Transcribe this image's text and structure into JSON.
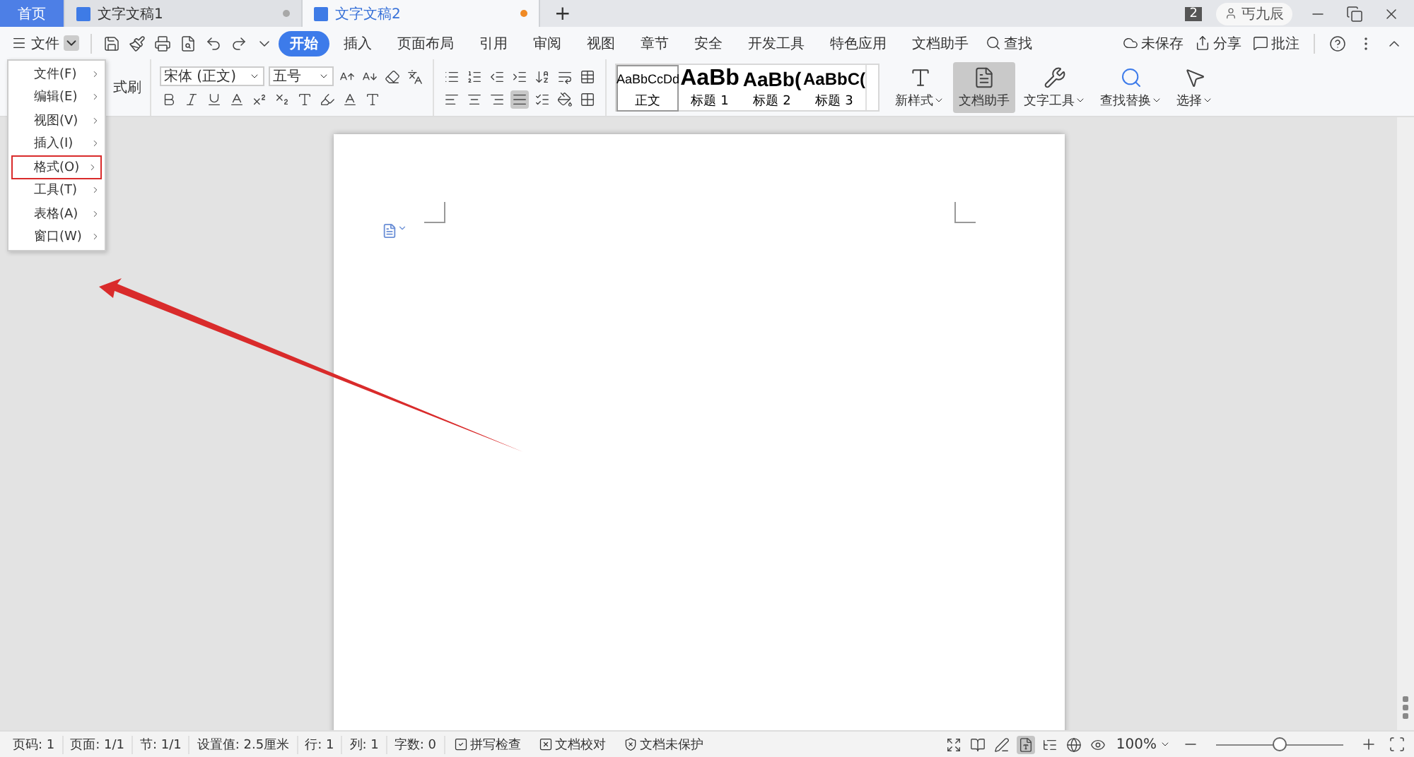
{
  "tabs": [
    {
      "label": "首页",
      "kind": "home"
    },
    {
      "label": "文字文稿1",
      "kind": "doc",
      "selected": false,
      "modified": false
    },
    {
      "label": "文字文稿2",
      "kind": "doc",
      "selected": true,
      "modified": true
    }
  ],
  "new_tab": "+",
  "window_count": "2",
  "user": "丐九辰",
  "file_menu": "文件",
  "ribbon_tabs": [
    {
      "label": "开始",
      "selected": true
    },
    {
      "label": "插入",
      "selected": false
    },
    {
      "label": "页面布局",
      "selected": false
    },
    {
      "label": "引用",
      "selected": false
    },
    {
      "label": "审阅",
      "selected": false
    },
    {
      "label": "视图",
      "selected": false
    },
    {
      "label": "章节",
      "selected": false
    },
    {
      "label": "安全",
      "selected": false
    },
    {
      "label": "开发工具",
      "selected": false
    },
    {
      "label": "特色应用",
      "selected": false
    },
    {
      "label": "文档助手",
      "selected": false
    }
  ],
  "search_tab": "查找",
  "right_actions": [
    {
      "kind": "cloud",
      "label": "未保存"
    },
    {
      "kind": "share",
      "label": "分享"
    },
    {
      "kind": "comment",
      "label": "批注"
    }
  ],
  "ribbon": {
    "format_painter": "式刷",
    "font": "宋体 (正文)",
    "size": "五号",
    "alignments": [
      {
        "kind": "left",
        "selected": false
      },
      {
        "kind": "center",
        "selected": false
      },
      {
        "kind": "right",
        "selected": false
      },
      {
        "kind": "justify",
        "selected": true
      }
    ],
    "styles": [
      {
        "preview": "AaBbCcDd",
        "label": "正文",
        "kind": "body",
        "selected": true
      },
      {
        "preview": "AaBb",
        "label": "标题 1",
        "kind": "h1",
        "selected": false
      },
      {
        "preview": "AaBb(",
        "label": "标题 2",
        "kind": "h2",
        "selected": false
      },
      {
        "preview": "AaBbC(",
        "label": "标题 3",
        "kind": "h3",
        "selected": false
      }
    ],
    "tools": [
      {
        "kind": "new_style",
        "label": "新样式",
        "selected": false,
        "dropdown": true
      },
      {
        "kind": "assistant",
        "label": "文档助手",
        "selected": true,
        "dropdown": false
      },
      {
        "kind": "text_tools",
        "label": "文字工具",
        "selected": false,
        "dropdown": true
      },
      {
        "kind": "find_replace",
        "label": "查找替换",
        "selected": false,
        "dropdown": true
      },
      {
        "kind": "select",
        "label": "选择",
        "selected": false,
        "dropdown": true
      }
    ]
  },
  "dropdown": [
    {
      "label": "文件(F)",
      "highlighted": false
    },
    {
      "label": "编辑(E)",
      "highlighted": false
    },
    {
      "label": "视图(V)",
      "highlighted": false
    },
    {
      "label": "插入(I)",
      "highlighted": false
    },
    {
      "label": "格式(O)",
      "highlighted": true
    },
    {
      "label": "工具(T)",
      "highlighted": false
    },
    {
      "label": "表格(A)",
      "highlighted": false
    },
    {
      "label": "窗口(W)",
      "highlighted": false
    }
  ],
  "status": {
    "items": [
      "页码: 1",
      "页面: 1/1",
      "节: 1/1",
      "设置值: 2.5厘米",
      "行: 1",
      "列: 1",
      "字数: 0"
    ],
    "tools": [
      {
        "kind": "spell",
        "label": "拼写检查"
      },
      {
        "kind": "proof",
        "label": "文档校对"
      },
      {
        "kind": "protect",
        "label": "文档未保护"
      }
    ],
    "view_modes": [
      {
        "kind": "fullscreen",
        "selected": false
      },
      {
        "kind": "reading",
        "selected": false
      },
      {
        "kind": "write",
        "selected": false
      },
      {
        "kind": "page",
        "selected": true
      },
      {
        "kind": "outline",
        "selected": false
      },
      {
        "kind": "web",
        "selected": false
      },
      {
        "kind": "eye",
        "selected": false
      }
    ],
    "zoom": "100%",
    "zoom_slider": {
      "level": 0.5
    }
  }
}
